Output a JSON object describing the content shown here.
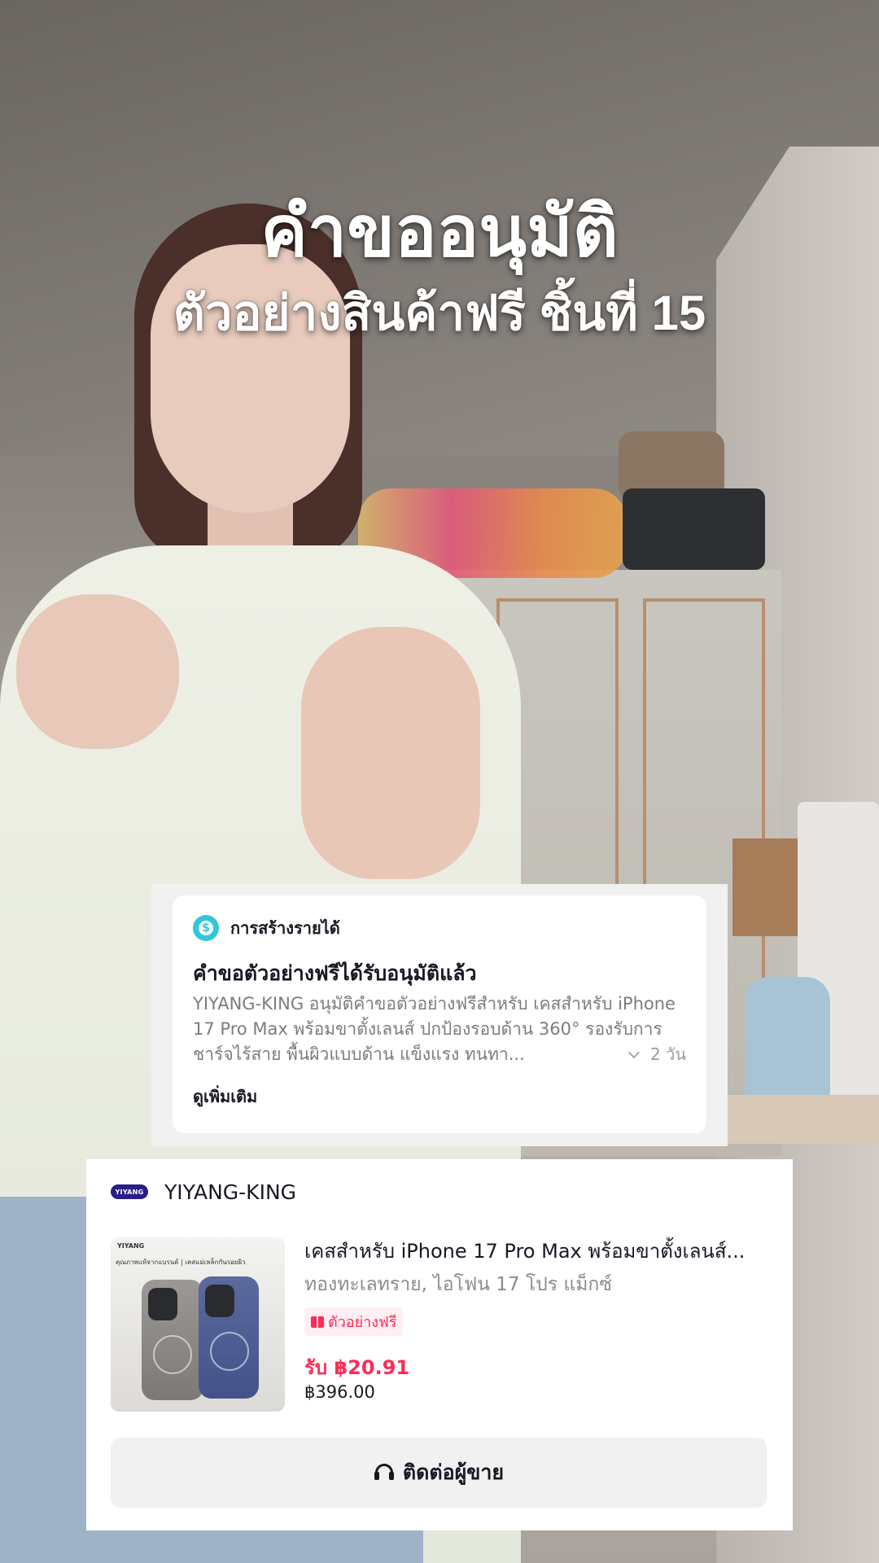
{
  "overlay": {
    "title": "คำขออนุมัติ",
    "subtitle": "ตัวอย่างสินค้าฟรี ชิ้นที่ 15"
  },
  "notification": {
    "category": "การสร้างรายได้",
    "category_icon": "dollar-circle-icon",
    "title": "คำขอตัวอย่างฟรีได้รับอนุมัติแล้ว",
    "body": "YIYANG-KING อนุมัติคำขอตัวอย่างฟรีสำหรับ เคสสำหรับ iPhone 17 Pro Max พร้อมขาตั้งเลนส์ ปกป้องรอบด้าน 360° รองรับการชาร์จไร้สาย พื้นผิวแบบด้าน แข็งแรง ทนทา...",
    "time": "2 วัน",
    "see_more": "ดูเพิ่มเติม",
    "accent_color": "#2fc8d8"
  },
  "product_card": {
    "shop_logo_text": "YIYANG",
    "shop_name": "YIYANG-KING",
    "thumbnail": {
      "brand": "YIYANG",
      "tagline": "คุณภาพแท้จากแบรนด์ | เคสแม่เหล็กกันรอยผิว"
    },
    "product_title": "เคสสำหรับ iPhone 17 Pro Max พร้อมขาตั้งเลนส์...",
    "variant": "ทองทะเลทราย, ไอโฟน 17 โปร แม็กซ์",
    "badge": "ตัวอย่างฟรี",
    "price_earn": "รับ ฿20.91",
    "price": "฿396.00",
    "contact_button": "ติดต่อผู้ขาย",
    "accent_color": "#fe2c55"
  }
}
